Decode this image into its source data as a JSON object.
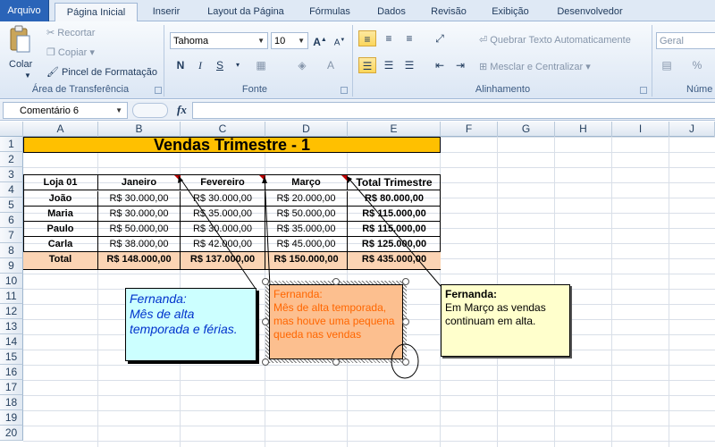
{
  "tabs": [
    "Arquivo",
    "Página Inicial",
    "Inserir",
    "Layout da Página",
    "Fórmulas",
    "Dados",
    "Revisão",
    "Exibição",
    "Desenvolvedor"
  ],
  "clipboard": {
    "paste": "Colar",
    "cut": "Recortar",
    "copy": "Copiar",
    "format_painter": "Pincel de Formatação",
    "label": "Área de Transferência"
  },
  "font": {
    "name": "Tahoma",
    "size": "10",
    "label": "Fonte",
    "bold": "N",
    "italic": "I",
    "underline": "S",
    "grow": "A",
    "shrink": "A",
    "color": "A"
  },
  "alignment": {
    "wrap": "Quebrar Texto Automaticamente",
    "merge": "Mesclar e Centralizar",
    "label": "Alinhamento"
  },
  "number": {
    "format": "Geral",
    "label": "Núme",
    "percent": "%"
  },
  "formula_bar": {
    "name_box": "Comentário 6",
    "fx": "fx",
    "value": ""
  },
  "columns": [
    "A",
    "B",
    "C",
    "D",
    "E",
    "F",
    "G",
    "H",
    "I",
    "J"
  ],
  "rows": [
    "1",
    "2",
    "3",
    "4",
    "5",
    "6",
    "7",
    "8",
    "9",
    "10",
    "11",
    "12",
    "13",
    "14",
    "15",
    "16",
    "17",
    "18",
    "19",
    "20"
  ],
  "sheet": {
    "title": "Vendas Trimestre - 1",
    "headers": [
      "Loja 01",
      "Janeiro",
      "Fevereiro",
      "Março",
      "Total Trimestre"
    ],
    "data": [
      [
        "João",
        "R$ 30.000,00",
        "R$ 30.000,00",
        "R$ 20.000,00",
        "R$ 80.000,00"
      ],
      [
        "Maria",
        "R$ 30.000,00",
        "R$ 35.000,00",
        "R$ 50.000,00",
        "R$ 115.000,00"
      ],
      [
        "Paulo",
        "R$ 50.000,00",
        "R$ 30.000,00",
        "R$ 35.000,00",
        "R$ 115.000,00"
      ],
      [
        "Carla",
        "R$ 38.000,00",
        "R$ 42.000,00",
        "R$ 45.000,00",
        "R$ 125.000,00"
      ]
    ],
    "total": [
      "Total",
      "R$ 148.000,00",
      "R$ 137.000,00",
      "R$ 150.000,00",
      "R$ 435.000,00"
    ]
  },
  "comments": {
    "c1": "Fernanda:\nMês de alta temporada e férias.",
    "c2": "Fernanda:\nMês de alta temporada, mas houve uma pequena queda nas vendas",
    "c3_author": "Fernanda:",
    "c3_text": "Em Março as vendas continuam em alta."
  },
  "colors": {
    "title_fill": "#ffc000",
    "total_fill": "#fbd4b4",
    "comment1_fill": "#ccffff",
    "comment2_fill": "#fcbf8f",
    "comment3_fill": "#ffffcc"
  }
}
